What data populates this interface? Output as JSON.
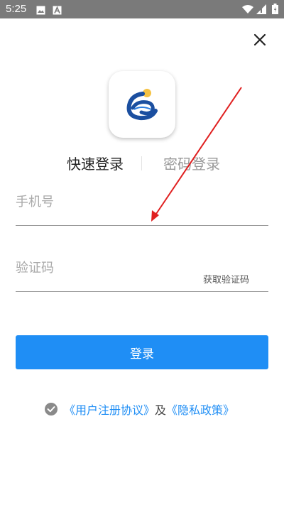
{
  "status_bar": {
    "time": "5:25",
    "icons": [
      "image-icon",
      "a-badge-icon",
      "wifi-icon",
      "signal-icon",
      "battery-icon"
    ],
    "background": "#7a7a7a"
  },
  "login": {
    "close_icon": "close-icon",
    "logo_icon": "app-logo",
    "tabs": [
      {
        "label": "快速登录",
        "active": true
      },
      {
        "label": "密码登录",
        "active": false
      }
    ],
    "phone_placeholder": "手机号",
    "code_placeholder": "验证码",
    "get_code_label": "获取验证码",
    "login_label": "登录",
    "agreement": {
      "check_icon": "check-circle-icon",
      "user_agreement": "《用户注册协议》",
      "conjunction": "及",
      "privacy_policy": "《隐私政策》"
    }
  },
  "colors": {
    "accent": "#1f8ef5",
    "annotation": "#e02020"
  }
}
